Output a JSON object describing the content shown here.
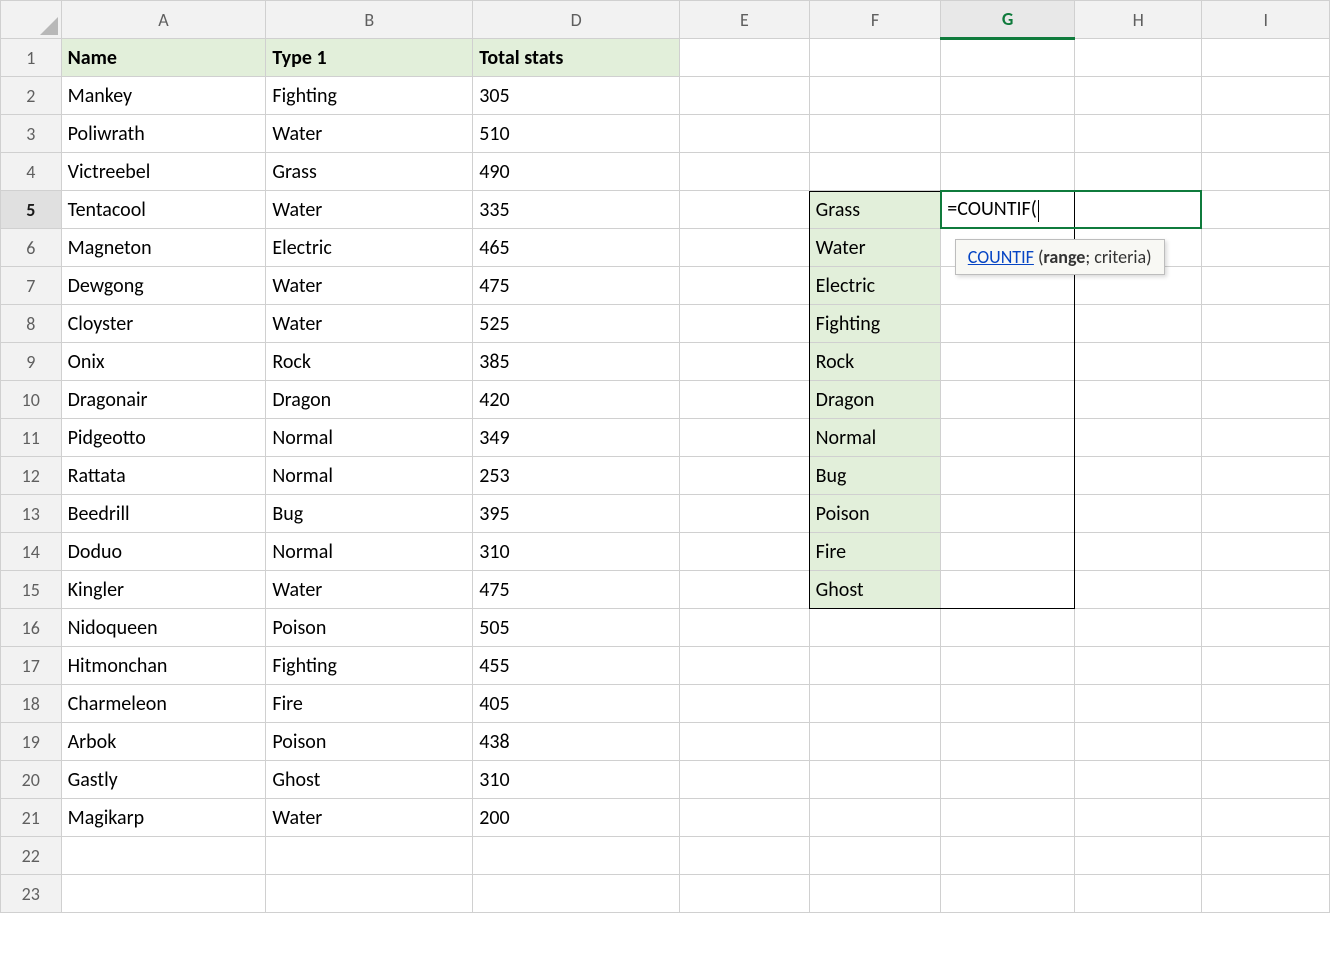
{
  "columns": [
    "A",
    "B",
    "D",
    "E",
    "F",
    "G",
    "H",
    "I"
  ],
  "rowsCount": 23,
  "headers": {
    "a": "Name",
    "b": "Type 1",
    "d": "Total stats"
  },
  "rows": [
    {
      "name": "Mankey",
      "type": "Fighting",
      "stats": "305"
    },
    {
      "name": "Poliwrath",
      "type": "Water",
      "stats": "510"
    },
    {
      "name": "Victreebel",
      "type": "Grass",
      "stats": "490"
    },
    {
      "name": "Tentacool",
      "type": "Water",
      "stats": "335"
    },
    {
      "name": "Magneton",
      "type": "Electric",
      "stats": "465"
    },
    {
      "name": "Dewgong",
      "type": "Water",
      "stats": "475"
    },
    {
      "name": "Cloyster",
      "type": "Water",
      "stats": "525"
    },
    {
      "name": "Onix",
      "type": "Rock",
      "stats": "385"
    },
    {
      "name": "Dragonair",
      "type": "Dragon",
      "stats": "420"
    },
    {
      "name": "Pidgeotto",
      "type": "Normal",
      "stats": "349"
    },
    {
      "name": "Rattata",
      "type": "Normal",
      "stats": "253"
    },
    {
      "name": "Beedrill",
      "type": "Bug",
      "stats": "395"
    },
    {
      "name": "Doduo",
      "type": "Normal",
      "stats": "310"
    },
    {
      "name": "Kingler",
      "type": "Water",
      "stats": "475"
    },
    {
      "name": "Nidoqueen",
      "type": "Poison",
      "stats": "505"
    },
    {
      "name": "Hitmonchan",
      "type": "Fighting",
      "stats": "455"
    },
    {
      "name": "Charmeleon",
      "type": "Fire",
      "stats": "405"
    },
    {
      "name": "Arbok",
      "type": "Poison",
      "stats": "438"
    },
    {
      "name": "Gastly",
      "type": "Ghost",
      "stats": "310"
    },
    {
      "name": "Magikarp",
      "type": "Water",
      "stats": "200"
    }
  ],
  "categories": [
    "Grass",
    "Water",
    "Electric",
    "Fighting",
    "Rock",
    "Dragon",
    "Normal",
    "Bug",
    "Poison",
    "Fire",
    "Ghost"
  ],
  "activeCell": {
    "formula": "=COUNTIF("
  },
  "tooltip": {
    "func": "COUNTIF",
    "open": " (",
    "arg1": "range",
    "sep": "; ",
    "arg2": "criteria",
    "close": ")"
  }
}
